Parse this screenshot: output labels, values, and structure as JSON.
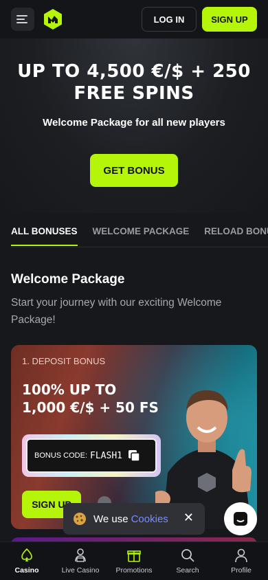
{
  "header": {
    "login_label": "LOG IN",
    "signup_label": "SIGN UP",
    "accent_color": "#b4f50a"
  },
  "hero": {
    "title_line1": "UP TO 4,500 €/$ + 250",
    "title_line2": "FREE SPINS",
    "subtitle": "Welcome Package for all new players",
    "cta_label": "GET BONUS"
  },
  "tabs": [
    {
      "label": "ALL BONUSES",
      "active": true
    },
    {
      "label": "WELCOME PACKAGE",
      "active": false
    },
    {
      "label": "RELOAD BONUS",
      "active": false
    }
  ],
  "section": {
    "title": "Welcome Package",
    "description": "Start your journey with our exciting Welcome Package!"
  },
  "card": {
    "step": "1. DEPOSIT BONUS",
    "title_line1": "100% UP TO",
    "title_line2": "1,000 €/$ + 50 FS",
    "code_label": "BONUS CODE:",
    "code_value": "FLASH1",
    "signup_label": "SIGN UP"
  },
  "cookie": {
    "text": "We use",
    "link": "Cookies"
  },
  "bottom_nav": [
    {
      "label": "Casino",
      "icon": "spade-icon",
      "active": true
    },
    {
      "label": "Live Casino",
      "icon": "dealer-icon",
      "active": false
    },
    {
      "label": "Promotions",
      "icon": "gift-icon",
      "active": false
    },
    {
      "label": "Search",
      "icon": "search-icon",
      "active": false
    },
    {
      "label": "Profile",
      "icon": "profile-icon",
      "active": false
    }
  ]
}
